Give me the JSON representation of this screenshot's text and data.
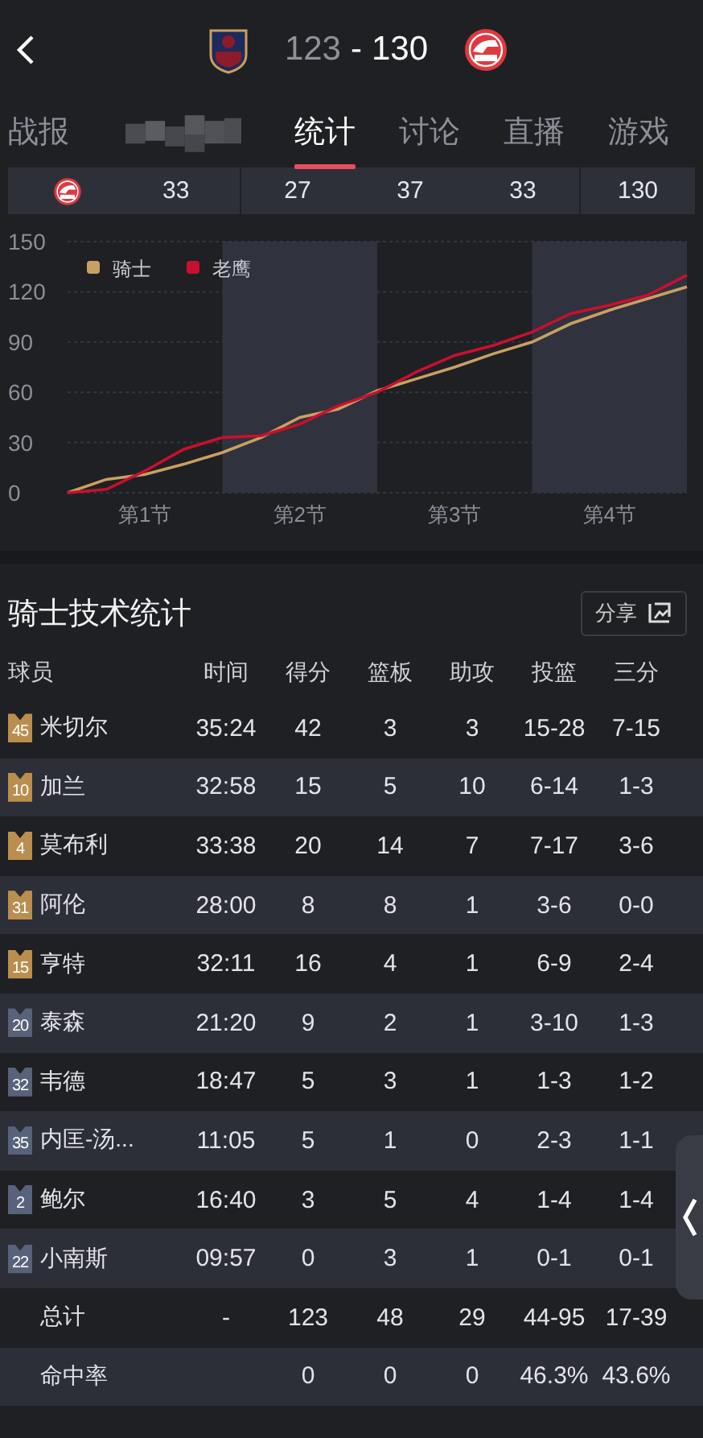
{
  "header": {
    "scores": [
      {
        "value": "123",
        "winner": false
      },
      {
        "value": "130",
        "winner": true
      }
    ],
    "separator": "-"
  },
  "tabs": [
    {
      "kind": "text",
      "label": "战报",
      "selected": false
    },
    {
      "kind": "blurred",
      "selected": false
    },
    {
      "kind": "text",
      "label": "统计",
      "selected": true
    },
    {
      "kind": "text",
      "label": "讨论",
      "selected": false
    },
    {
      "kind": "text",
      "label": "直播",
      "selected": false
    },
    {
      "kind": "text",
      "label": "游戏",
      "selected": false
    }
  ],
  "quarter_scores": [
    "33",
    "27",
    "37",
    "33"
  ],
  "quarter_total": "130",
  "chart": {
    "chart_data": {
      "type": "line",
      "grid": true,
      "legend": true,
      "categories": [
        null,
        null,
        "第1节",
        null,
        null,
        null,
        "第2节",
        null,
        null,
        null,
        "第3节",
        null,
        null,
        null,
        "第4节",
        null,
        null
      ],
      "ylim": [
        0,
        150
      ],
      "yticks": [
        0,
        30,
        60,
        90,
        120,
        150
      ],
      "series": [
        {
          "name": "骑士",
          "color": "#c9a063",
          "values": [
            0,
            8,
            11,
            17,
            24,
            33,
            45,
            50,
            61,
            68,
            75,
            83,
            90,
            101,
            109,
            116,
            123
          ]
        },
        {
          "name": "老鹰",
          "color": "#c8102e",
          "values": [
            0,
            2,
            13,
            26,
            33,
            34,
            41,
            52,
            60,
            72,
            82,
            88,
            96,
            107,
            112,
            118,
            130
          ]
        }
      ]
    }
  },
  "stats": {
    "title": "骑士技术统计",
    "share": "分享",
    "columns": [
      "球员",
      "时间",
      "得分",
      "篮板",
      "助攻",
      "投篮",
      "三分"
    ],
    "rows": [
      {
        "kind": "player",
        "number": "45",
        "starter": true,
        "cells": [
          "米切尔",
          "35:24",
          "42",
          "3",
          "3",
          "15-28",
          "7-15"
        ]
      },
      {
        "kind": "player",
        "number": "10",
        "starter": true,
        "cells": [
          "加兰",
          "32:58",
          "15",
          "5",
          "10",
          "6-14",
          "1-3"
        ]
      },
      {
        "kind": "player",
        "number": "4",
        "starter": true,
        "cells": [
          "莫布利",
          "33:38",
          "20",
          "14",
          "7",
          "7-17",
          "3-6"
        ]
      },
      {
        "kind": "player",
        "number": "31",
        "starter": true,
        "cells": [
          "阿伦",
          "28:00",
          "8",
          "8",
          "1",
          "3-6",
          "0-0"
        ]
      },
      {
        "kind": "player",
        "number": "15",
        "starter": true,
        "cells": [
          "亨特",
          "32:11",
          "16",
          "4",
          "1",
          "6-9",
          "2-4"
        ]
      },
      {
        "kind": "player",
        "number": "20",
        "starter": false,
        "cells": [
          "泰森",
          "21:20",
          "9",
          "2",
          "1",
          "3-10",
          "1-3"
        ]
      },
      {
        "kind": "player",
        "number": "32",
        "starter": false,
        "cells": [
          "韦德",
          "18:47",
          "5",
          "3",
          "1",
          "1-3",
          "1-2"
        ]
      },
      {
        "kind": "player",
        "number": "35",
        "starter": false,
        "cells": [
          "内匡-汤...",
          "11:05",
          "5",
          "1",
          "0",
          "2-3",
          "1-1"
        ]
      },
      {
        "kind": "player",
        "number": "2",
        "starter": false,
        "cells": [
          "鲍尔",
          "16:40",
          "3",
          "5",
          "4",
          "1-4",
          "1-4"
        ]
      },
      {
        "kind": "player",
        "number": "22",
        "starter": false,
        "cells": [
          "小南斯",
          "09:57",
          "0",
          "3",
          "1",
          "0-1",
          "0-1"
        ]
      },
      {
        "kind": "summary",
        "cells": [
          "总计",
          "-",
          "123",
          "48",
          "29",
          "44-95",
          "17-39"
        ]
      },
      {
        "kind": "summary",
        "cells": [
          "命中率",
          null,
          "0",
          "0",
          "0",
          "46.3%",
          "43.6%"
        ]
      }
    ]
  }
}
